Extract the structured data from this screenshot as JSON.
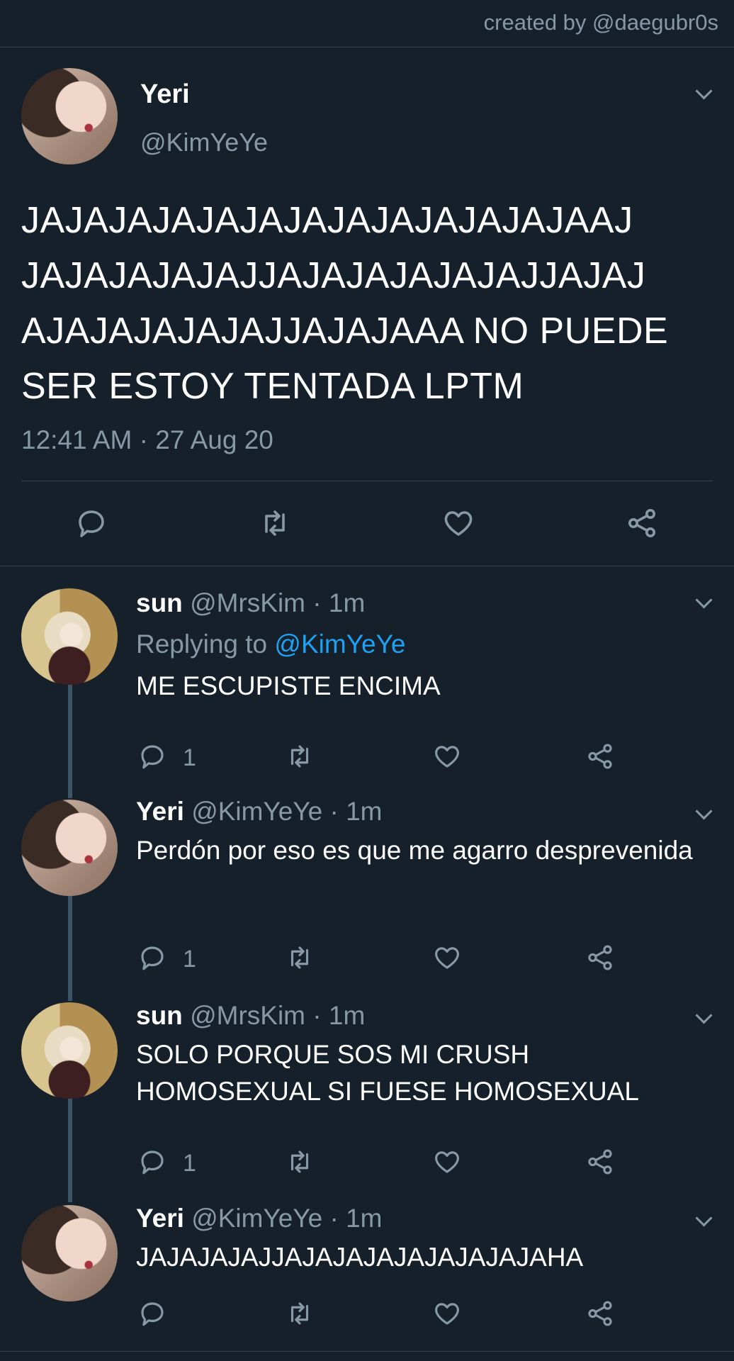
{
  "credit": "created by @daegubr0s",
  "colors": {
    "background": "#15202b",
    "muted": "#8899a6",
    "link": "#1da1f2",
    "divider": "#38444d"
  },
  "main_tweet": {
    "name": "Yeri",
    "handle": "@KimYeYe",
    "text": "JAJAJAJAJAJAJAJAJAJAJAJAJAAJ JAJAJAJAJAJJAJAJAJAJAJAJJAJAJ AJAJAJAJAJAJJAJAJAAA NO PUEDE SER ESTOY TENTADA LPTM",
    "timestamp": "12:41 AM · 27 Aug 20",
    "actions": [
      "reply-icon",
      "retweet-icon",
      "like-icon",
      "share-icon"
    ]
  },
  "replies": [
    {
      "name": "sun",
      "handle": "@MrsKim",
      "time": "· 1m",
      "replying_label": "Replying to",
      "replying_to": "@KimYeYe",
      "text": "ME ESCUPISTE ENCIMA",
      "reply_count": "1"
    },
    {
      "name": "Yeri",
      "handle": "@KimYeYe",
      "time": "· 1m",
      "text": "Perdón por eso es que me agarro desprevenida",
      "reply_count": "1"
    },
    {
      "name": "sun",
      "handle": "@MrsKim",
      "time": "· 1m",
      "text": "SOLO PORQUE SOS MI CRUSH HOMOSEXUAL SI FUESE HOMOSEXUAL",
      "reply_count": "1"
    },
    {
      "name": "Yeri",
      "handle": "@KimYeYe",
      "time": "· 1m",
      "text": "JAJAJAJAJJAJAJAJAJAJAJAJAJAHA",
      "reply_count": ""
    }
  ]
}
